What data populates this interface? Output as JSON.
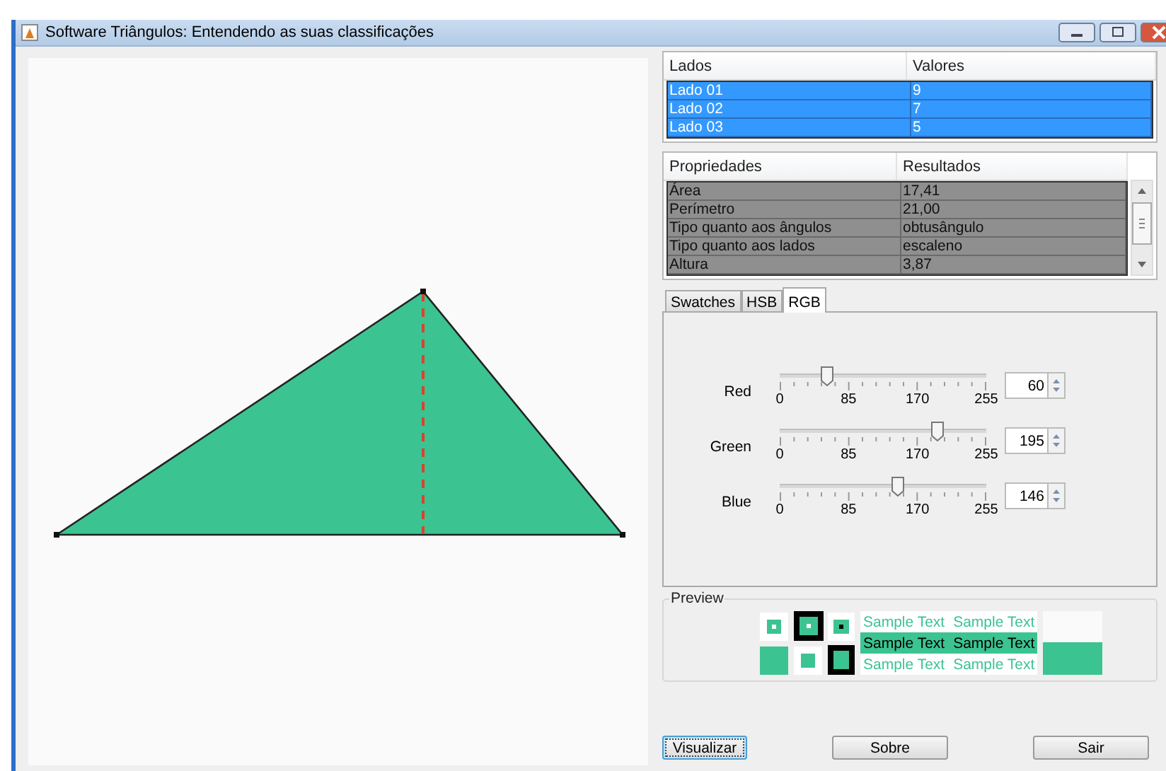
{
  "window": {
    "title": "Software Triângulos: Entendendo as suas classificações"
  },
  "sides_table": {
    "columns": [
      "Lados",
      "Valores"
    ],
    "rows": [
      {
        "cells": [
          "Lado 01",
          "9"
        ],
        "selected": true
      },
      {
        "cells": [
          "Lado 02",
          "7"
        ],
        "selected": true
      },
      {
        "cells": [
          "Lado 03",
          "5"
        ],
        "selected": true
      }
    ]
  },
  "properties_table": {
    "columns": [
      "Propriedades",
      "Resultados"
    ],
    "disabled": true,
    "rows": [
      {
        "cells": [
          "Área",
          "17,41"
        ]
      },
      {
        "cells": [
          "Perímetro",
          "21,00"
        ]
      },
      {
        "cells": [
          "Tipo quanto aos ângulos",
          "obtusângulo"
        ]
      },
      {
        "cells": [
          "Tipo quanto aos lados",
          "escaleno"
        ]
      },
      {
        "cells": [
          "Altura",
          "3,87"
        ]
      }
    ]
  },
  "tabs": [
    {
      "label": "Swatches",
      "selected": false
    },
    {
      "label": "HSB",
      "selected": false
    },
    {
      "label": "RGB",
      "selected": true
    }
  ],
  "sliders": [
    {
      "label": "Red",
      "level": 0.235,
      "reading": "60",
      "ticks": [
        "0",
        "85",
        "170",
        "255"
      ]
    },
    {
      "label": "Green",
      "level": 0.765,
      "reading": "195",
      "ticks": [
        "0",
        "85",
        "170",
        "255"
      ]
    },
    {
      "label": "Blue",
      "level": 0.573,
      "reading": "146",
      "ticks": [
        "0",
        "85",
        "170",
        "255"
      ]
    }
  ],
  "preview": {
    "title": "Preview",
    "rows": [
      {
        "kind": "light",
        "texts": [
          "Sample Text",
          "Sample Text"
        ]
      },
      {
        "kind": "filled",
        "texts": [
          "Sample Text",
          "Sample Text"
        ]
      },
      {
        "kind": "light",
        "texts": [
          "Sample Text",
          "Sample Text"
        ]
      }
    ]
  },
  "buttons": [
    {
      "label": "Visualizar",
      "focused": true
    },
    {
      "label": "Sobre",
      "focused": false
    },
    {
      "label": "Sair",
      "focused": false
    }
  ]
}
